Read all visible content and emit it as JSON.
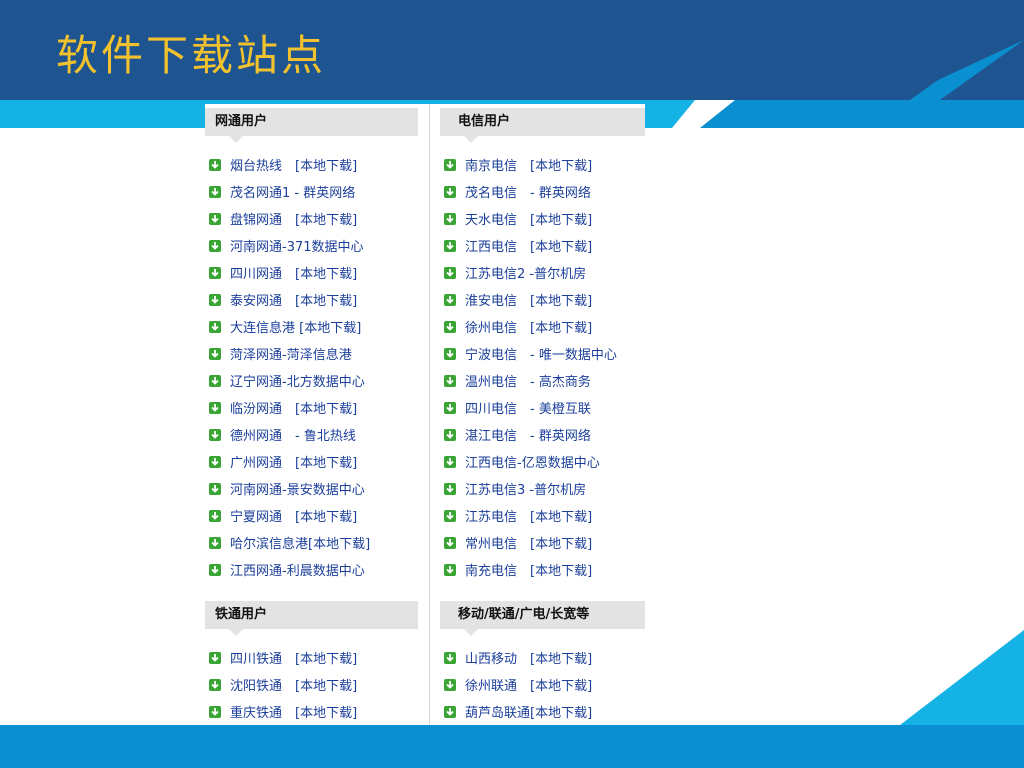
{
  "slide": {
    "title": "软件下载站点"
  },
  "colors": {
    "header": "#1e5490",
    "title": "#f2c12e",
    "accent": "#0a8fd0",
    "link": "#1b3f9a",
    "icon": "#3aa535"
  },
  "icon": "download-arrow-icon",
  "sections": [
    {
      "title": "网通用户",
      "items": [
        "烟台热线　[本地下载]",
        "茂名网通1 - 群英网络",
        "盘锦网通　[本地下载]",
        "河南网通-371数据中心",
        "四川网通　[本地下载]",
        "泰安网通　[本地下载]",
        "大连信息港 [本地下载]",
        "菏泽网通-菏泽信息港",
        "辽宁网通-北方数据中心",
        "临汾网通　[本地下载]",
        "德州网通　- 鲁北热线",
        "广州网通　[本地下载]",
        "河南网通-景安数据中心",
        "宁夏网通　[本地下载]",
        "哈尔滨信息港[本地下载]",
        "江西网通-利晨数据中心"
      ]
    },
    {
      "title": "电信用户",
      "items": [
        "南京电信　[本地下载]",
        "茂名电信　- 群英网络",
        "天水电信　[本地下载]",
        "江西电信　[本地下载]",
        "江苏电信2 -普尔机房",
        "淮安电信　[本地下载]",
        "徐州电信　[本地下载]",
        "宁波电信　- 唯一数据中心",
        "温州电信　- 高杰商务",
        "四川电信　- 美橙互联",
        "湛江电信　- 群英网络",
        "江西电信-亿恩数据中心",
        "江苏电信3 -普尔机房",
        "江苏电信　[本地下载]",
        "常州电信　[本地下载]",
        "南充电信　[本地下载]"
      ]
    },
    {
      "title": "铁通用户",
      "items": [
        "四川铁通　[本地下载]",
        "沈阳铁通　[本地下载]",
        "重庆铁通　[本地下载]"
      ]
    },
    {
      "title": "移动/联通/广电/长宽等",
      "items": [
        "山西移动　[本地下载]",
        "徐州联通　[本地下载]",
        "葫芦岛联通[本地下载]"
      ]
    }
  ]
}
